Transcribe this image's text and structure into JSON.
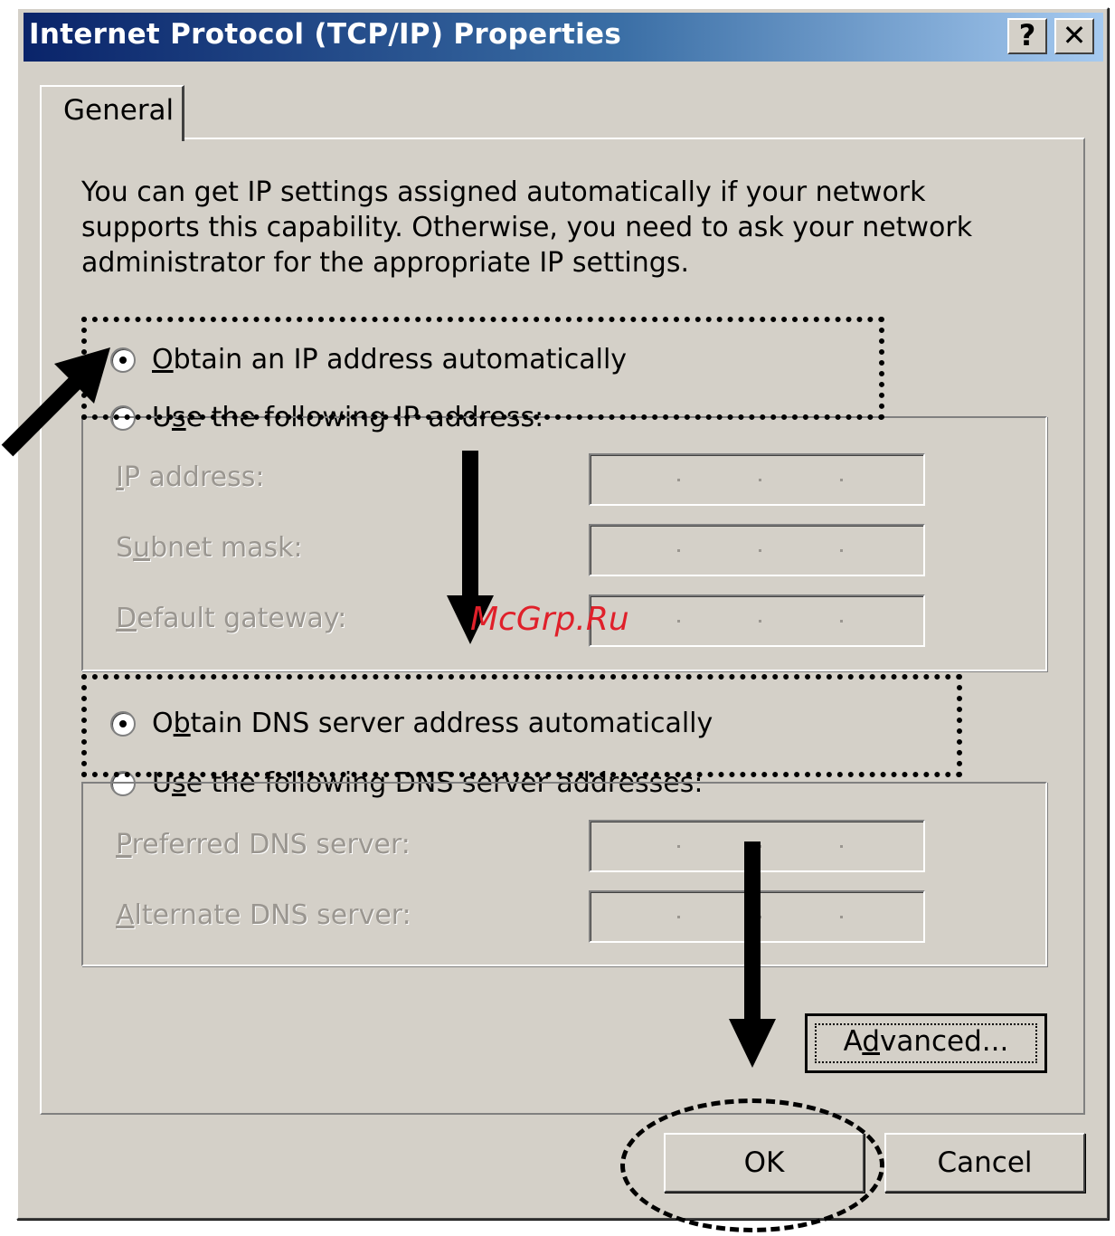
{
  "window": {
    "title": "Internet Protocol (TCP/IP) Properties",
    "help_button": "?",
    "close_button": "✕"
  },
  "tabs": [
    {
      "label": "General",
      "selected": true
    }
  ],
  "description": "You can get IP settings assigned automatically if your network supports this capability. Otherwise, you need to ask your network administrator for the appropriate IP settings.",
  "ip_options": {
    "auto": {
      "mnemonic": "O",
      "rest": "btain an IP address automatically",
      "selected": true
    },
    "manual": {
      "pre": "U",
      "mnemonic": "s",
      "rest": "e the following IP address:",
      "selected": false
    }
  },
  "ip_fields": {
    "ip_address": {
      "pre": "",
      "mnemonic": "I",
      "rest": "P address:"
    },
    "subnet_mask": {
      "pre": "S",
      "mnemonic": "u",
      "rest": "bnet mask:"
    },
    "default_gateway": {
      "pre": "",
      "mnemonic": "D",
      "rest": "efault gateway:"
    }
  },
  "dns_options": {
    "auto": {
      "pre": "O",
      "mnemonic": "b",
      "rest": "tain DNS server address automatically",
      "selected": true
    },
    "manual": {
      "pre": "U",
      "mnemonic": "s",
      "rest": "e the following DNS server addresses:",
      "selected": false
    }
  },
  "dns_fields": {
    "preferred": {
      "pre": "",
      "mnemonic": "P",
      "rest": "referred DNS server:"
    },
    "alternate": {
      "pre": "",
      "mnemonic": "A",
      "rest": "lternate DNS server:"
    }
  },
  "buttons": {
    "advanced": {
      "pre": "A",
      "mnemonic": "d",
      "rest": "vanced..."
    },
    "ok": "OK",
    "cancel": "Cancel"
  },
  "watermark": "McGrp.Ru"
}
